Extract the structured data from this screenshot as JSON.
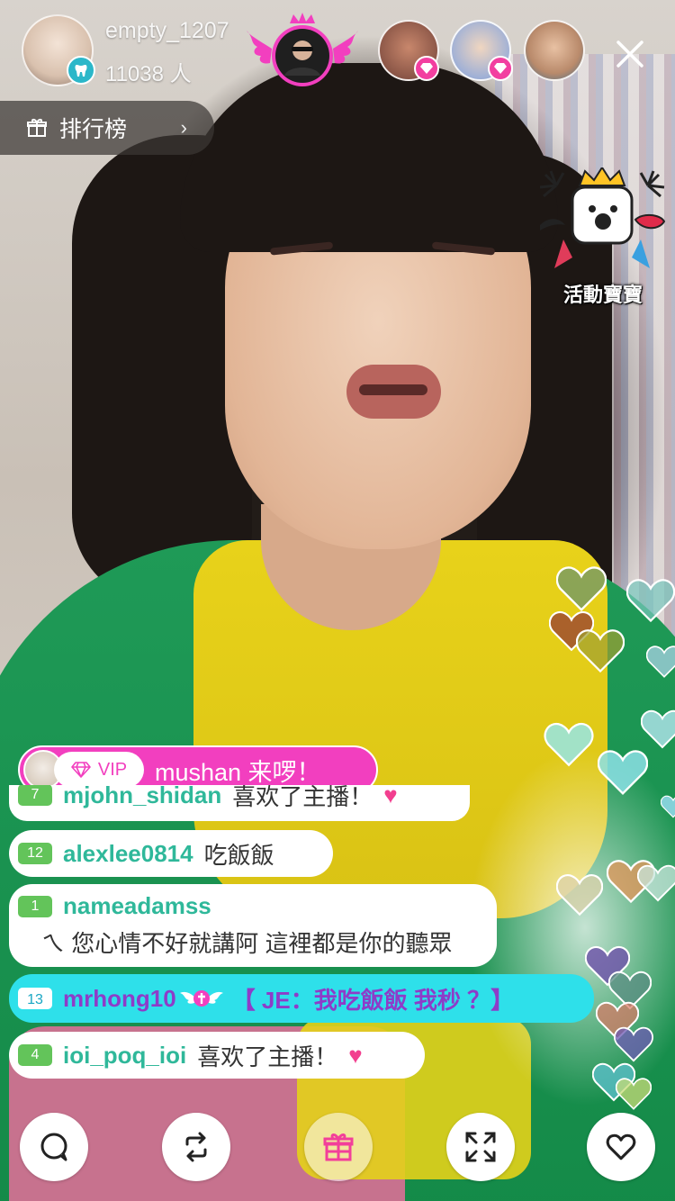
{
  "host": {
    "name": "empty_1207",
    "viewers": "11038 人"
  },
  "rank": {
    "label": "排行榜"
  },
  "event": {
    "label": "活動寶寶"
  },
  "vip_entry": {
    "tag": "VIP",
    "text": "mushan 来啰！"
  },
  "chat": {
    "partial": {
      "user": "mjohn_shidan",
      "text": "喜欢了主播！"
    },
    "messages": [
      {
        "level": "12",
        "user": "alexlee0814",
        "text": "吃飯飯"
      },
      {
        "level": "1",
        "user": "nameadamss",
        "text": "ㄟ 您心情不好就講阿 這裡都是你的聽眾"
      },
      {
        "level": "13",
        "user": "mrhong10",
        "text": "【 JE：我吃飯飯 我秒 ？】"
      },
      {
        "level": "4",
        "user": "ioi_poq_ioi",
        "text": "喜欢了主播！"
      }
    ]
  },
  "toolbar": {
    "chat_icon": "chat-bubble-icon",
    "share_icon": "repost-icon",
    "gift_icon": "gift-icon",
    "fullscreen_icon": "fullscreen-icon",
    "like_icon": "heart-icon"
  },
  "colors": {
    "vip_pink": "#f23fbf",
    "highlight_cyan": "#2ee0ea",
    "level_green": "#63c45a",
    "username_teal": "#2fb89a"
  }
}
